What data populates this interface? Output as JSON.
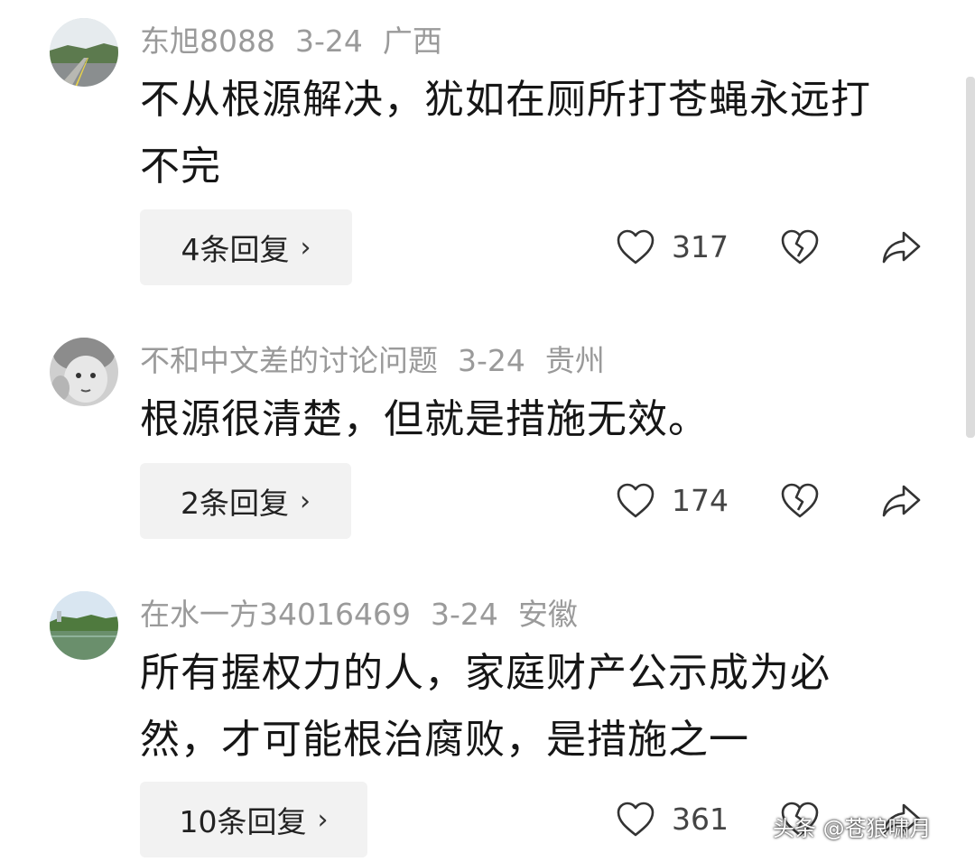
{
  "comments": [
    {
      "username": "东旭8088",
      "date": "3-24",
      "location": "广西",
      "text": "不从根源解决，犹如在厕所打苍蝇永远打不完",
      "replies_label": "4条回复",
      "likes": "317",
      "avatar_icon": "road-landscape-avatar"
    },
    {
      "username": "不和中文差的讨论问题",
      "date": "3-24",
      "location": "贵州",
      "text": "根源很清楚，但就是措施无效。",
      "replies_label": "2条回复",
      "likes": "174",
      "avatar_icon": "baby-face-avatar"
    },
    {
      "username": "在水一方34016469",
      "date": "3-24",
      "location": "安徽",
      "text": "所有握权力的人，家庭财产公示成为必然，才可能根治腐败，是措施之一",
      "replies_label": "10条回复",
      "likes": "361",
      "avatar_icon": "lake-landscape-avatar"
    }
  ],
  "icons": {
    "like": "heart-outline-icon",
    "dislike": "broken-heart-icon",
    "share": "share-arrow-icon",
    "reply_chevron": "chevron-right-icon"
  },
  "chevron_glyph": "›",
  "watermark": "头条 @苍狼啸月",
  "colors": {
    "meta_text": "#9a9a9a",
    "reply_bg": "#f2f2f2",
    "icon_stroke": "#333333"
  }
}
